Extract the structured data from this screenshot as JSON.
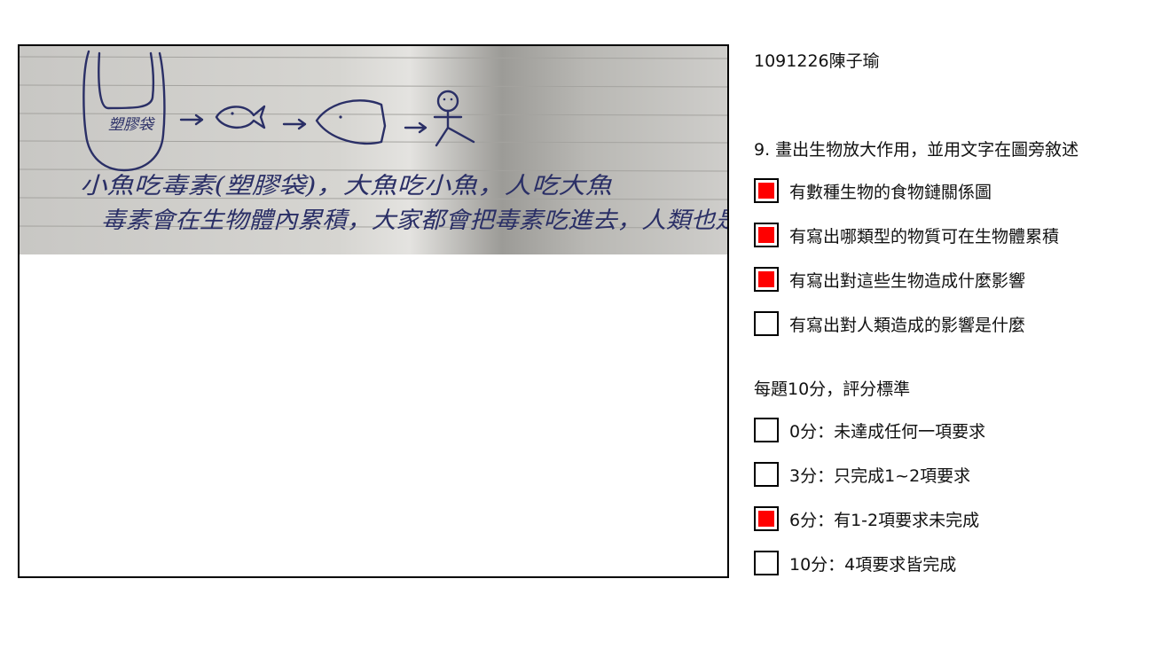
{
  "student": {
    "id_name": "1091226陳子瑜"
  },
  "question": {
    "title": "9. 畫出生物放大作用，並用文字在圖旁敘述"
  },
  "criteria": [
    {
      "label": "有數種生物的食物鏈關係圖",
      "checked": true
    },
    {
      "label": "有寫出哪類型的物質可在生物體累積",
      "checked": true
    },
    {
      "label": "有寫出對這些生物造成什麼影響",
      "checked": true
    },
    {
      "label": "有寫出對人類造成的影響是什麼",
      "checked": false
    }
  ],
  "scoring": {
    "title": "每題10分，評分標準",
    "options": [
      {
        "label": "0分：未達成任何一項要求",
        "checked": false
      },
      {
        "label": "3分：只完成1~2項要求",
        "checked": false
      },
      {
        "label": "6分：有1-2項要求未完成",
        "checked": true
      },
      {
        "label": "10分：4項要求皆完成",
        "checked": false
      }
    ]
  },
  "answer_photo": {
    "handwritten_line1": "小魚吃毒素(塑膠袋)，大魚吃小魚，人吃大魚",
    "handwritten_line2": "毒素會在生物體內累積，大家都會把毒素吃進去，人類也是",
    "bag_label": "塑膠袋"
  },
  "colors": {
    "check_fill": "#ff0000",
    "ink": "#2a2f66",
    "paper": "#cfcfca"
  }
}
